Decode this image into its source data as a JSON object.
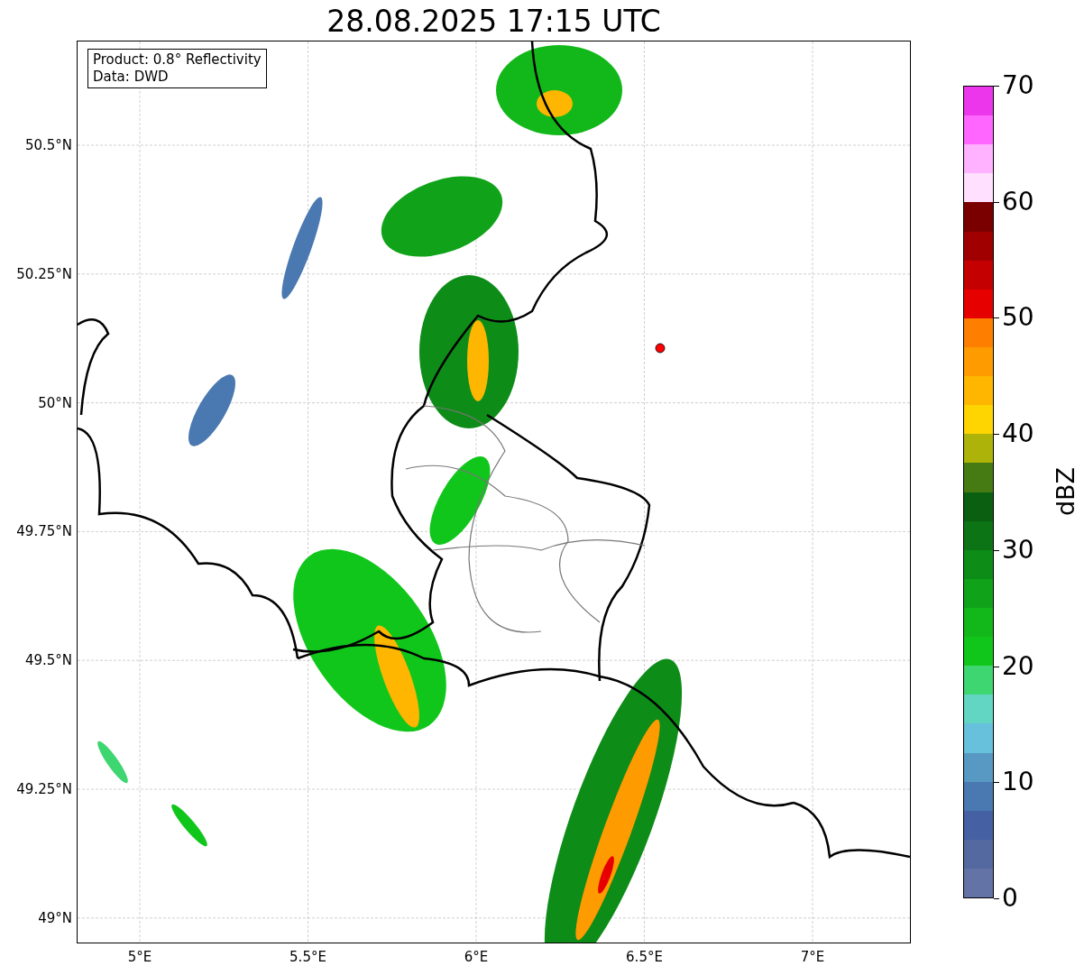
{
  "title": "28.08.2025 17:15 UTC",
  "info_box": {
    "lines": [
      "Product: 0.8° Reflectivity",
      "Data: DWD"
    ]
  },
  "map": {
    "y_ticks": [
      "50.5°N",
      "50.25°N",
      "50°N",
      "49.75°N",
      "49.5°N",
      "49.25°N",
      "49°N"
    ],
    "x_ticks": [
      "5°E",
      "5.5°E",
      "6°E",
      "6.5°E",
      "7°E"
    ]
  },
  "colorbar": {
    "label": "dBZ",
    "ticks": [
      "70",
      "60",
      "50",
      "40",
      "30",
      "20",
      "10",
      "0"
    ],
    "segments": [
      {
        "color": "#ec36ec"
      },
      {
        "color": "#ff66ff"
      },
      {
        "color": "#ffb2ff"
      },
      {
        "color": "#ffe0ff"
      },
      {
        "color": "#7a0000"
      },
      {
        "color": "#a00000"
      },
      {
        "color": "#c50000"
      },
      {
        "color": "#e60000"
      },
      {
        "color": "#fe7f00"
      },
      {
        "color": "#fe9b00"
      },
      {
        "color": "#feb600"
      },
      {
        "color": "#fed500"
      },
      {
        "color": "#aeb30a"
      },
      {
        "color": "#467a12"
      },
      {
        "color": "#0a5f10"
      },
      {
        "color": "#0c7414"
      },
      {
        "color": "#0e8c18"
      },
      {
        "color": "#10a31a"
      },
      {
        "color": "#12b81a"
      },
      {
        "color": "#11c61b"
      },
      {
        "color": "#3dd670"
      },
      {
        "color": "#62d6c3"
      },
      {
        "color": "#67c1dc"
      },
      {
        "color": "#5799c2"
      },
      {
        "color": "#4a78b0"
      },
      {
        "color": "#4560a3"
      },
      {
        "color": "#5369a0"
      },
      {
        "color": "#6373a6"
      }
    ]
  }
}
